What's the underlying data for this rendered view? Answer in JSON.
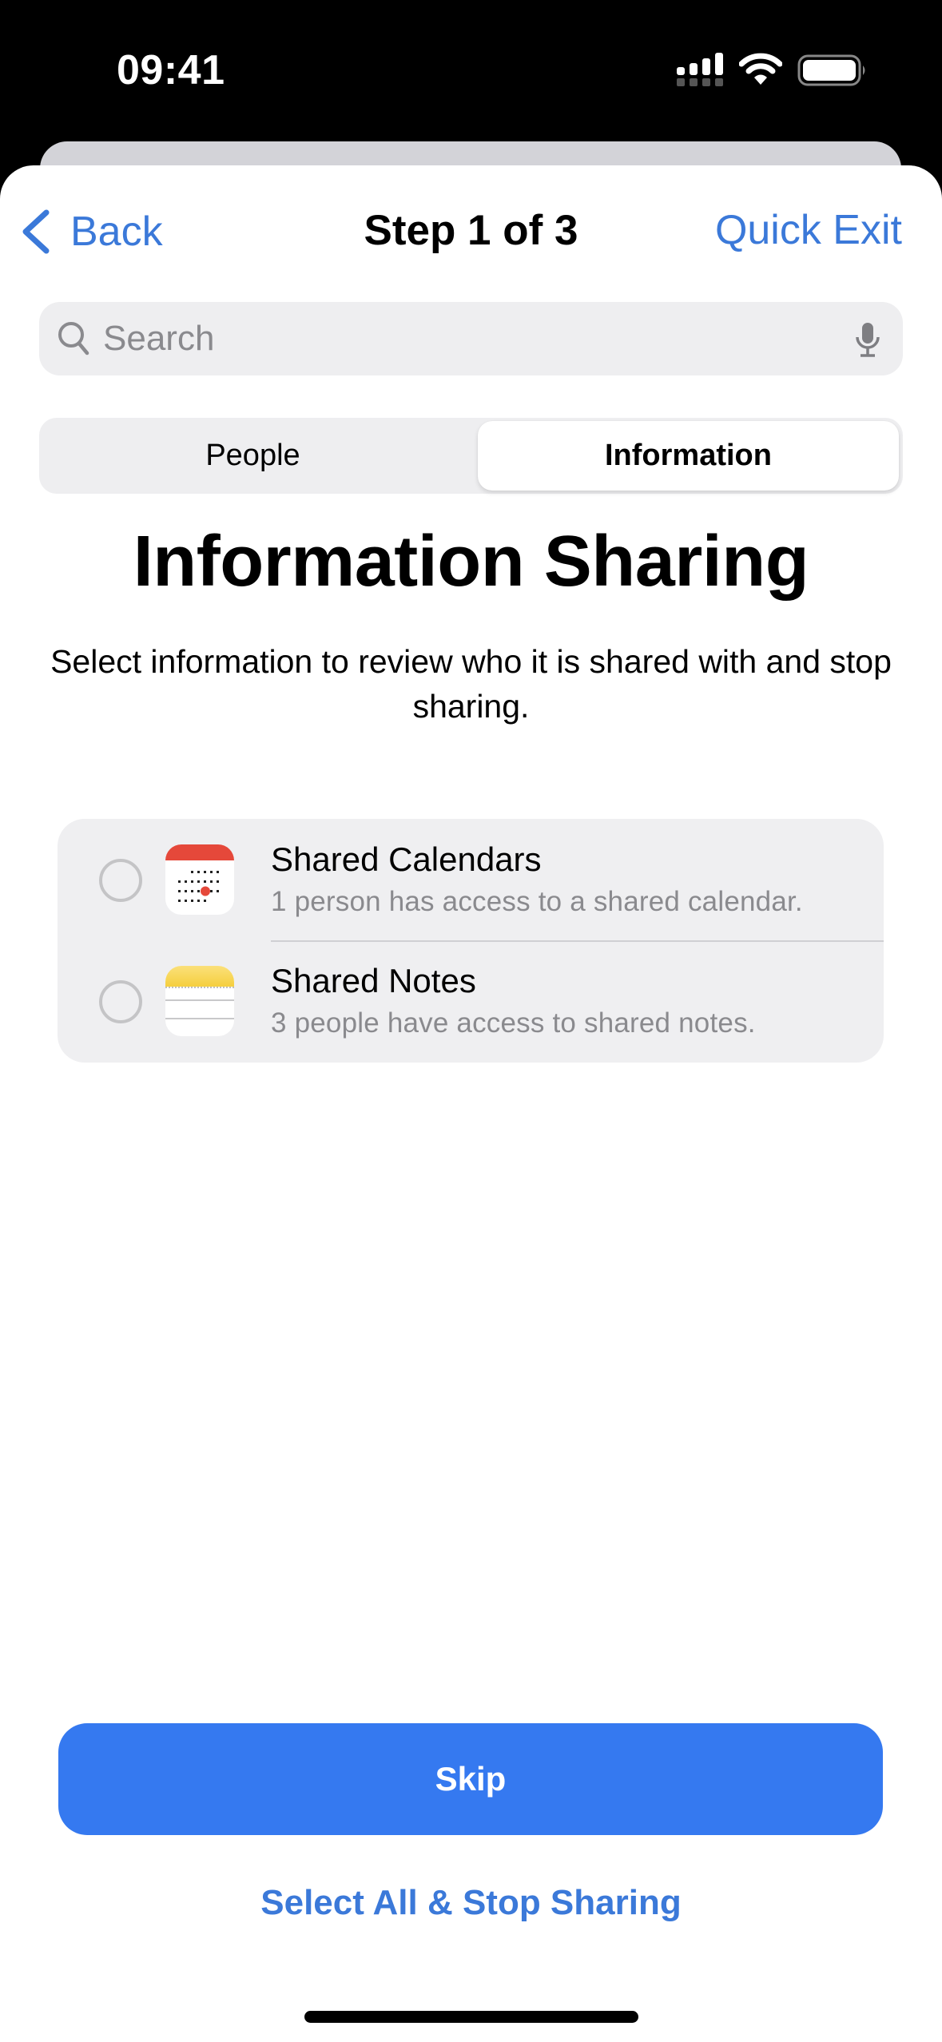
{
  "status_bar": {
    "time": "09:41",
    "icons": [
      "cellular-signal-icon",
      "wifi-icon",
      "battery-icon"
    ]
  },
  "nav": {
    "back_label": "Back",
    "title": "Step 1 of 3",
    "quick_exit_label": "Quick Exit"
  },
  "search": {
    "placeholder": "Search",
    "value": ""
  },
  "segmented_control": {
    "tabs": [
      {
        "label": "People",
        "selected": false
      },
      {
        "label": "Information",
        "selected": true
      }
    ]
  },
  "main": {
    "heading": "Information Sharing",
    "subtitle": "Select information to review who it is shared with and stop sharing."
  },
  "items": [
    {
      "title": "Shared Calendars",
      "subtitle": "1 person has access to a shared calendar.",
      "icon": "calendar-app-icon",
      "checked": false
    },
    {
      "title": "Shared Notes",
      "subtitle": "3 people have access to shared notes.",
      "icon": "notes-app-icon",
      "checked": false
    }
  ],
  "footer": {
    "primary_button": "Skip",
    "secondary_button": "Select All & Stop Sharing"
  },
  "colors": {
    "accent": "#3b79d9",
    "primary_button": "#3579f0",
    "calendar_red": "#e5483a",
    "notes_yellow": "#f6d54a"
  }
}
